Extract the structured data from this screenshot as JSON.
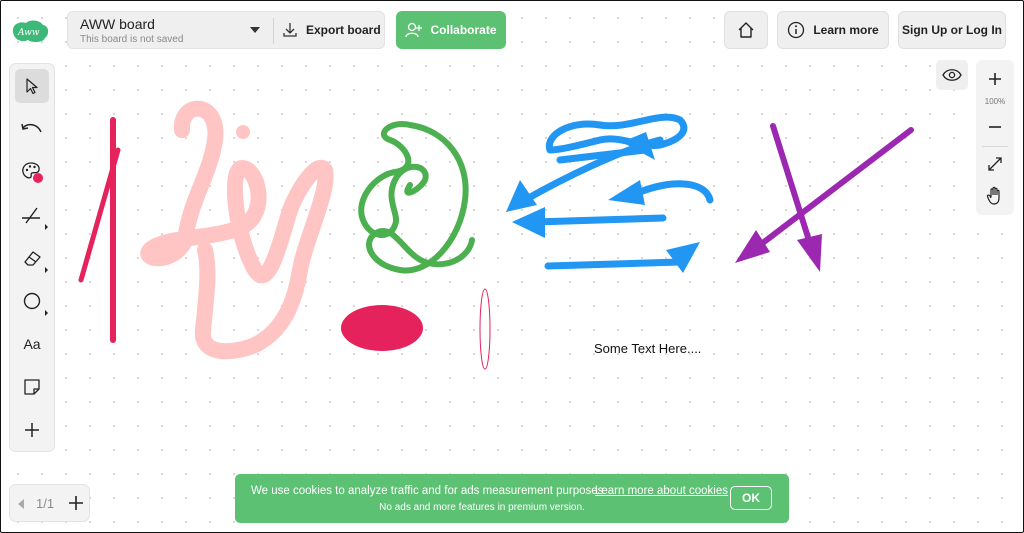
{
  "header": {
    "logo_text": "Aww",
    "board_title": "AWW board",
    "board_subtitle": "This board is not saved",
    "export_label": "Export board",
    "collaborate_label": "Collaborate",
    "home_icon": "home-icon",
    "learn_more_label": "Learn more",
    "signup_label": "Sign Up or Log In"
  },
  "toolbar": {
    "tools": [
      "select-tool",
      "undo-tool",
      "color-palette-tool",
      "pen-tool",
      "eraser-tool",
      "shape-tool",
      "text-tool",
      "sticky-note-tool",
      "add-tool"
    ],
    "text_tool_label": "Aa",
    "active_color": "#e5225b"
  },
  "pager": {
    "page_label": "1/1"
  },
  "zoom": {
    "level": "100%"
  },
  "canvas": {
    "text_note": "Some Text Here...."
  },
  "cookie_banner": {
    "message": "We use cookies to analyze traffic and for ads measurement purposes",
    "link": "Learn more about cookies",
    "sub": "No ads and more features in premium version.",
    "ok_label": "OK"
  },
  "colors": {
    "accent_green": "#5dc174",
    "stroke_red": "#e5225b",
    "stroke_pink": "#ffc4c4",
    "stroke_green": "#4caf50",
    "stroke_blue": "#2196f3",
    "stroke_purple": "#9c27b0"
  }
}
